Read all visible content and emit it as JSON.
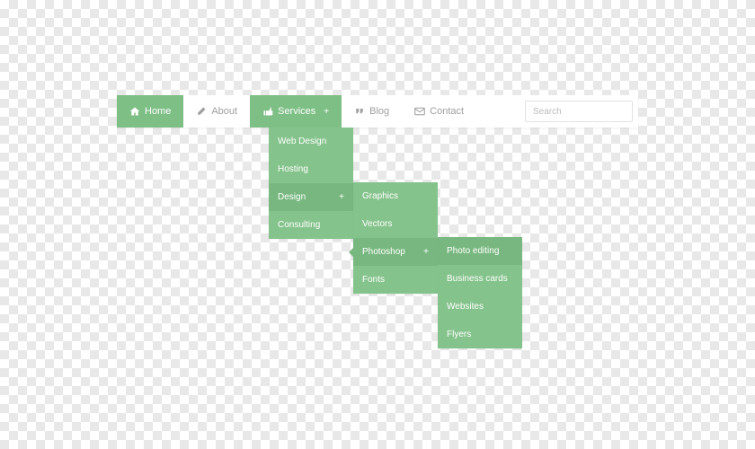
{
  "colors": {
    "accent": "#7ebf86",
    "accent_hover": "#78b880",
    "text_muted": "#9e9e9e"
  },
  "nav": {
    "home": {
      "label": "Home",
      "icon": "home-icon"
    },
    "about": {
      "label": "About",
      "icon": "pencil-icon"
    },
    "services": {
      "label": "Services",
      "icon": "thumb-up-icon",
      "expand": "+"
    },
    "blog": {
      "label": "Blog",
      "icon": "quote-icon"
    },
    "contact": {
      "label": "Contact",
      "icon": "envelope-icon"
    }
  },
  "search": {
    "placeholder": "Search",
    "value": ""
  },
  "menu": {
    "services": {
      "items": [
        {
          "label": "Web Design"
        },
        {
          "label": "Hosting"
        },
        {
          "label": "Design",
          "expand": "+"
        },
        {
          "label": "Consulting"
        }
      ]
    },
    "design": {
      "items": [
        {
          "label": "Graphics"
        },
        {
          "label": "Vectors"
        },
        {
          "label": "Photoshop",
          "expand": "+"
        },
        {
          "label": "Fonts"
        }
      ]
    },
    "photoshop": {
      "items": [
        {
          "label": "Photo editing"
        },
        {
          "label": "Business cards"
        },
        {
          "label": "Websites"
        },
        {
          "label": "Flyers"
        }
      ]
    }
  }
}
